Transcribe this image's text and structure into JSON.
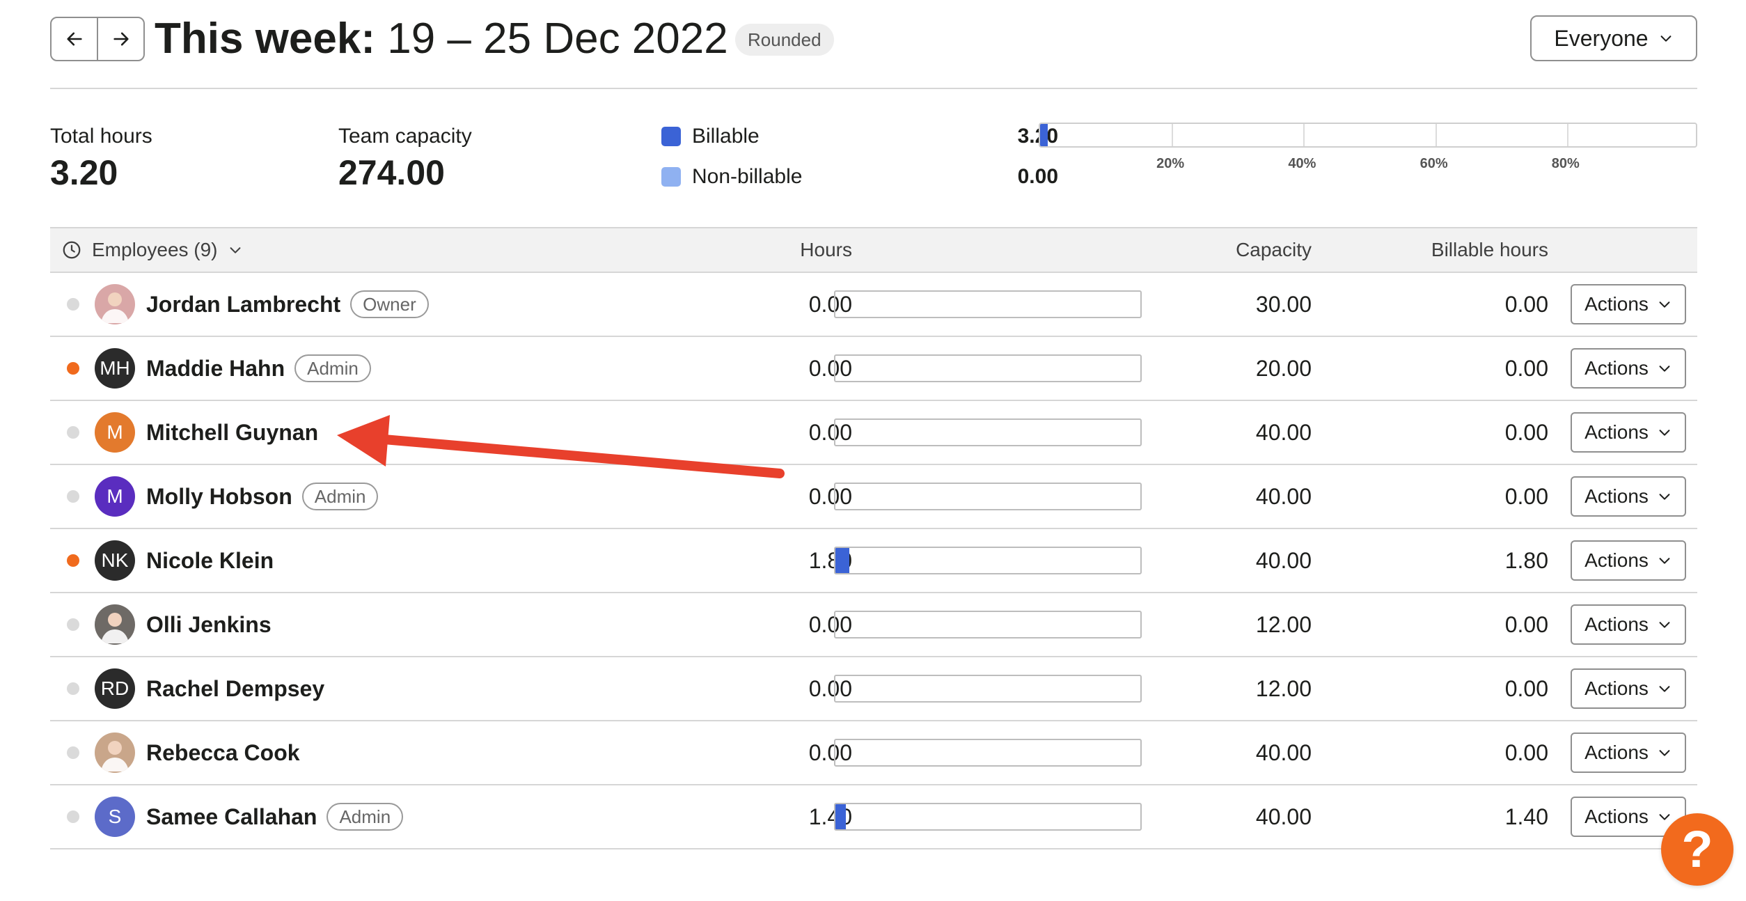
{
  "header": {
    "prev_icon": "arrow-left-icon",
    "next_icon": "arrow-right-icon",
    "title_prefix": "This week:",
    "title_dates": "19 – 25 Dec 2022",
    "rounded_badge": "Rounded",
    "filter_label": "Everyone"
  },
  "summary": {
    "total_hours_label": "Total hours",
    "total_hours_value": "3.20",
    "team_capacity_label": "Team capacity",
    "team_capacity_value": "274.00",
    "billable_label": "Billable",
    "billable_value": "3.20",
    "nonbillable_label": "Non-billable",
    "nonbillable_value": "0.00",
    "billable_fraction": 0.012,
    "ticks": [
      "20%",
      "40%",
      "60%",
      "80%"
    ],
    "colors": {
      "billable": "#3b63d6",
      "nonbillable": "#8fb1f1"
    }
  },
  "table": {
    "employees_toggle": "Employees (9)",
    "col_hours": "Hours",
    "col_capacity": "Capacity",
    "col_billable": "Billable hours",
    "actions_label": "Actions",
    "rows": [
      {
        "name": "Jordan Lambrecht",
        "role": "Owner",
        "status": "grey",
        "avatar_initials": "",
        "avatar_color": "#d9a7a7",
        "avatar_photo": true,
        "hours": "0.00",
        "fill": 0,
        "capacity": "30.00",
        "billable": "0.00"
      },
      {
        "name": "Maddie Hahn",
        "role": "Admin",
        "status": "orange",
        "avatar_initials": "MH",
        "avatar_color": "#2b2b2b",
        "avatar_photo": false,
        "hours": "0.00",
        "fill": 0,
        "capacity": "20.00",
        "billable": "0.00"
      },
      {
        "name": "Mitchell Guynan",
        "role": "",
        "status": "grey",
        "avatar_initials": "M",
        "avatar_color": "#e37a2d",
        "avatar_photo": false,
        "hours": "0.00",
        "fill": 0,
        "capacity": "40.00",
        "billable": "0.00"
      },
      {
        "name": "Molly Hobson",
        "role": "Admin",
        "status": "grey",
        "avatar_initials": "M",
        "avatar_color": "#5a2dbf",
        "avatar_photo": false,
        "hours": "0.00",
        "fill": 0,
        "capacity": "40.00",
        "billable": "0.00"
      },
      {
        "name": "Nicole Klein",
        "role": "",
        "status": "orange",
        "avatar_initials": "NK",
        "avatar_color": "#2b2b2b",
        "avatar_photo": false,
        "hours": "1.80",
        "fill": 0.045,
        "capacity": "40.00",
        "billable": "1.80"
      },
      {
        "name": "Olli Jenkins",
        "role": "",
        "status": "grey",
        "avatar_initials": "",
        "avatar_color": "#6e6a66",
        "avatar_photo": true,
        "hours": "0.00",
        "fill": 0,
        "capacity": "12.00",
        "billable": "0.00"
      },
      {
        "name": "Rachel Dempsey",
        "role": "",
        "status": "grey",
        "avatar_initials": "RD",
        "avatar_color": "#2b2b2b",
        "avatar_photo": false,
        "hours": "0.00",
        "fill": 0,
        "capacity": "12.00",
        "billable": "0.00"
      },
      {
        "name": "Rebecca Cook",
        "role": "",
        "status": "grey",
        "avatar_initials": "",
        "avatar_color": "#c9a68a",
        "avatar_photo": true,
        "hours": "0.00",
        "fill": 0,
        "capacity": "40.00",
        "billable": "0.00"
      },
      {
        "name": "Samee Callahan",
        "role": "Admin",
        "status": "grey",
        "avatar_initials": "S",
        "avatar_color": "#5c6bc9",
        "avatar_photo": false,
        "hours": "1.40",
        "fill": 0.035,
        "capacity": "40.00",
        "billable": "1.40"
      }
    ]
  },
  "help_button": "?",
  "help_icon": "question-mark-icon",
  "annotation": {
    "type": "arrow",
    "color": "#e8402c",
    "points_to": "Mitchell Guynan"
  }
}
